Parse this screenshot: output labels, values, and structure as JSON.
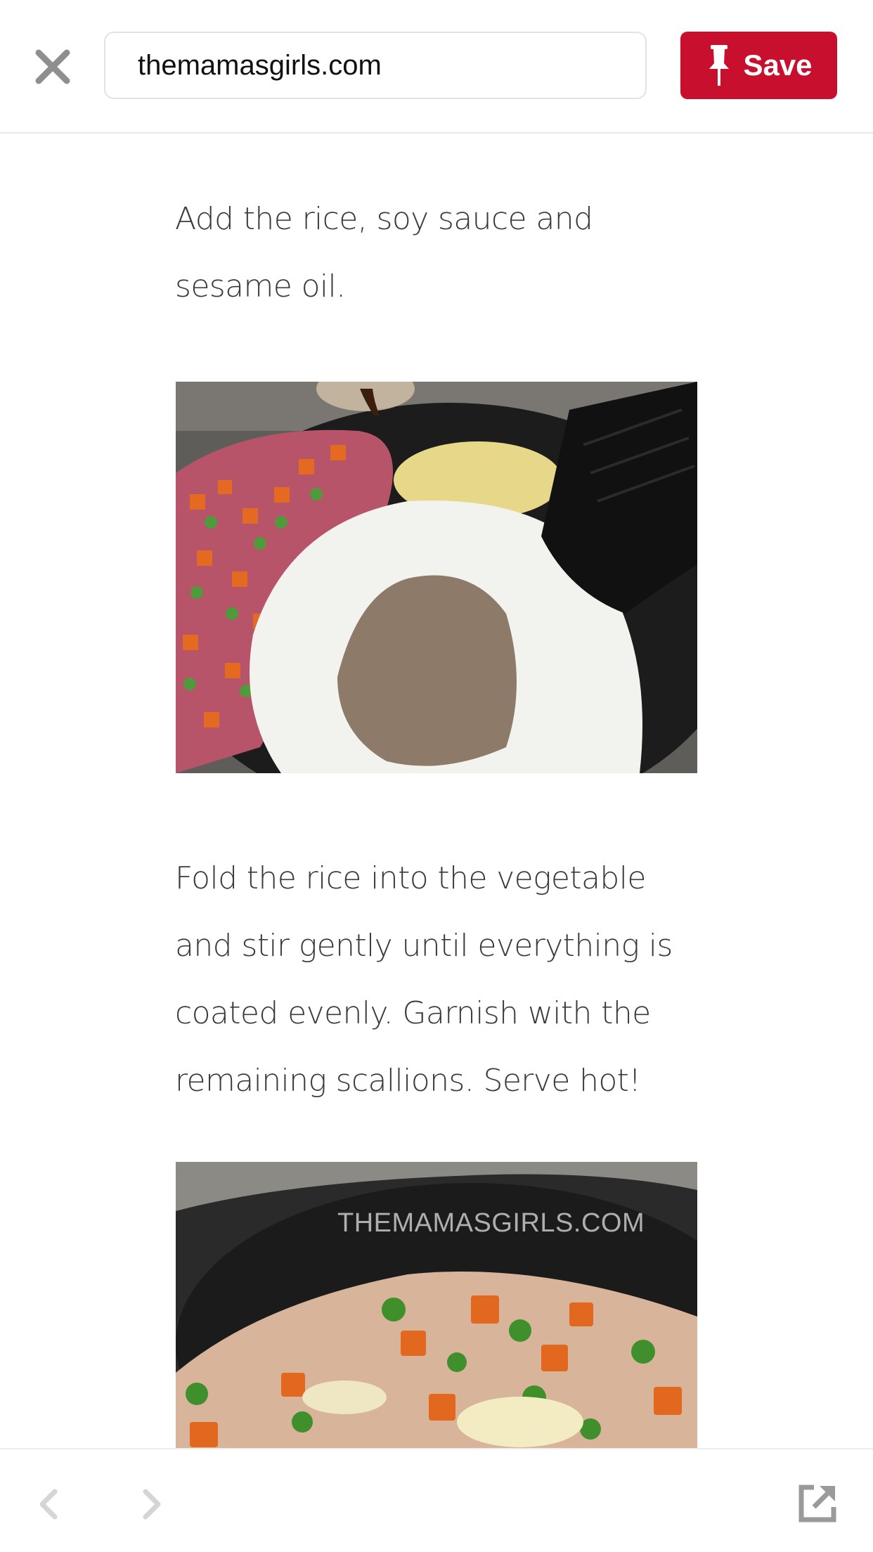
{
  "header": {
    "url": "themamasgirls.com",
    "save_label": "Save",
    "save_color": "#c8102e"
  },
  "icons": {
    "close": "close-icon",
    "pin": "pushpin-icon",
    "back": "chevron-left-icon",
    "forward": "chevron-right-icon",
    "external": "open-external-icon"
  },
  "article": {
    "step1": "Add the rice, soy sauce and sesame oil.",
    "step2": "Fold the rice into the vegetable and stir gently until everything is coated evenly. Garnish with the remaining scallions. Serve hot!",
    "photo2_watermark": "THEMAMASGIRLS.COM"
  }
}
